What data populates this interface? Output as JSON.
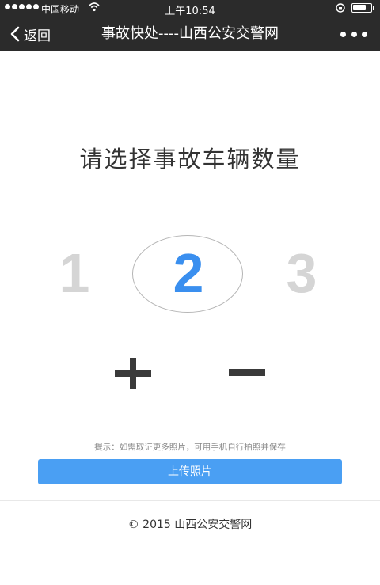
{
  "status_bar": {
    "carrier": "中国移动",
    "time": "上午10:54",
    "icons": [
      "signal-dots-icon",
      "wifi-icon",
      "orientation-lock-icon",
      "battery-icon"
    ]
  },
  "nav": {
    "back_label": "返回",
    "title": "事故快处----山西公安交警网",
    "icons": [
      "chevron-left-icon",
      "more-dots-icon"
    ]
  },
  "main": {
    "heading": "请选择事故车辆数量",
    "options": [
      "1",
      "2",
      "3"
    ],
    "selected": "2",
    "increment_icon": "plus-icon",
    "decrement_icon": "minus-icon"
  },
  "hint": "提示：如需取证更多照片，可用手机自行拍照并保存",
  "upload_button": "上传照片",
  "footer": "© 2015 山西公安交警网",
  "colors": {
    "bar": "#2b2b2b",
    "accent": "#3a8fef",
    "button": "#4a9ff3",
    "inactive_number": "#d5d5d5"
  }
}
